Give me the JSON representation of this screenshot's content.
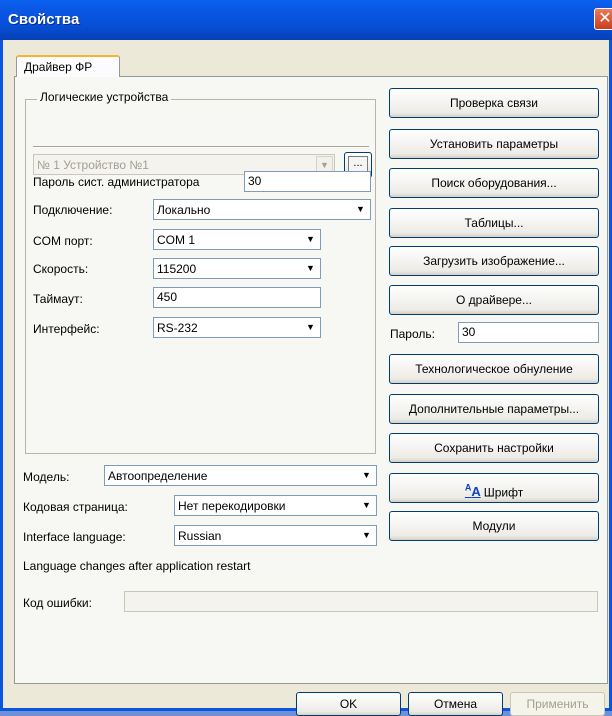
{
  "window": {
    "title": "Свойства"
  },
  "tabs": [
    {
      "label": "Драйвер ФР"
    }
  ],
  "logical_devices": {
    "group_label": "Логические устройства",
    "selected_device": "№ 1 Устройство №1",
    "ellipsis_label": "..."
  },
  "form": {
    "admin_password_label": "Пароль сист. администратора",
    "admin_password_value": "30",
    "connection_label": "Подключение:",
    "connection_value": "Локально",
    "com_port_label": "COM порт:",
    "com_port_value": "COM 1",
    "speed_label": "Скорость:",
    "speed_value": "115200",
    "timeout_label": "Таймаут:",
    "timeout_value": "450",
    "interface_label": "Интерфейс:",
    "interface_value": "RS-232"
  },
  "bottom_settings": {
    "model_label": "Модель:",
    "model_value": "Автоопределение",
    "codepage_label": "Кодовая страница:",
    "codepage_value": "Нет перекодировки",
    "language_label": "Interface language:",
    "language_value": "Russian",
    "language_note": "Language changes after application restart",
    "error_code_label": "Код ошибки:",
    "error_code_value": ""
  },
  "buttons": {
    "check_connection": "Проверка связи",
    "set_params": "Установить параметры",
    "search_equipment": "Поиск оборудования...",
    "tables": "Таблицы...",
    "load_image": "Загрузить изображение...",
    "about_driver": "О драйвере...",
    "password_label": "Пароль:",
    "password_value": "30",
    "tech_reset": "Технологическое обнуление",
    "additional_params": "Дополнительные параметры...",
    "save_settings": "Сохранить настройки",
    "font": "Шрифт",
    "modules": "Модули"
  },
  "dialog_buttons": {
    "ok": "OK",
    "cancel": "Отмена",
    "apply": "Применить"
  }
}
